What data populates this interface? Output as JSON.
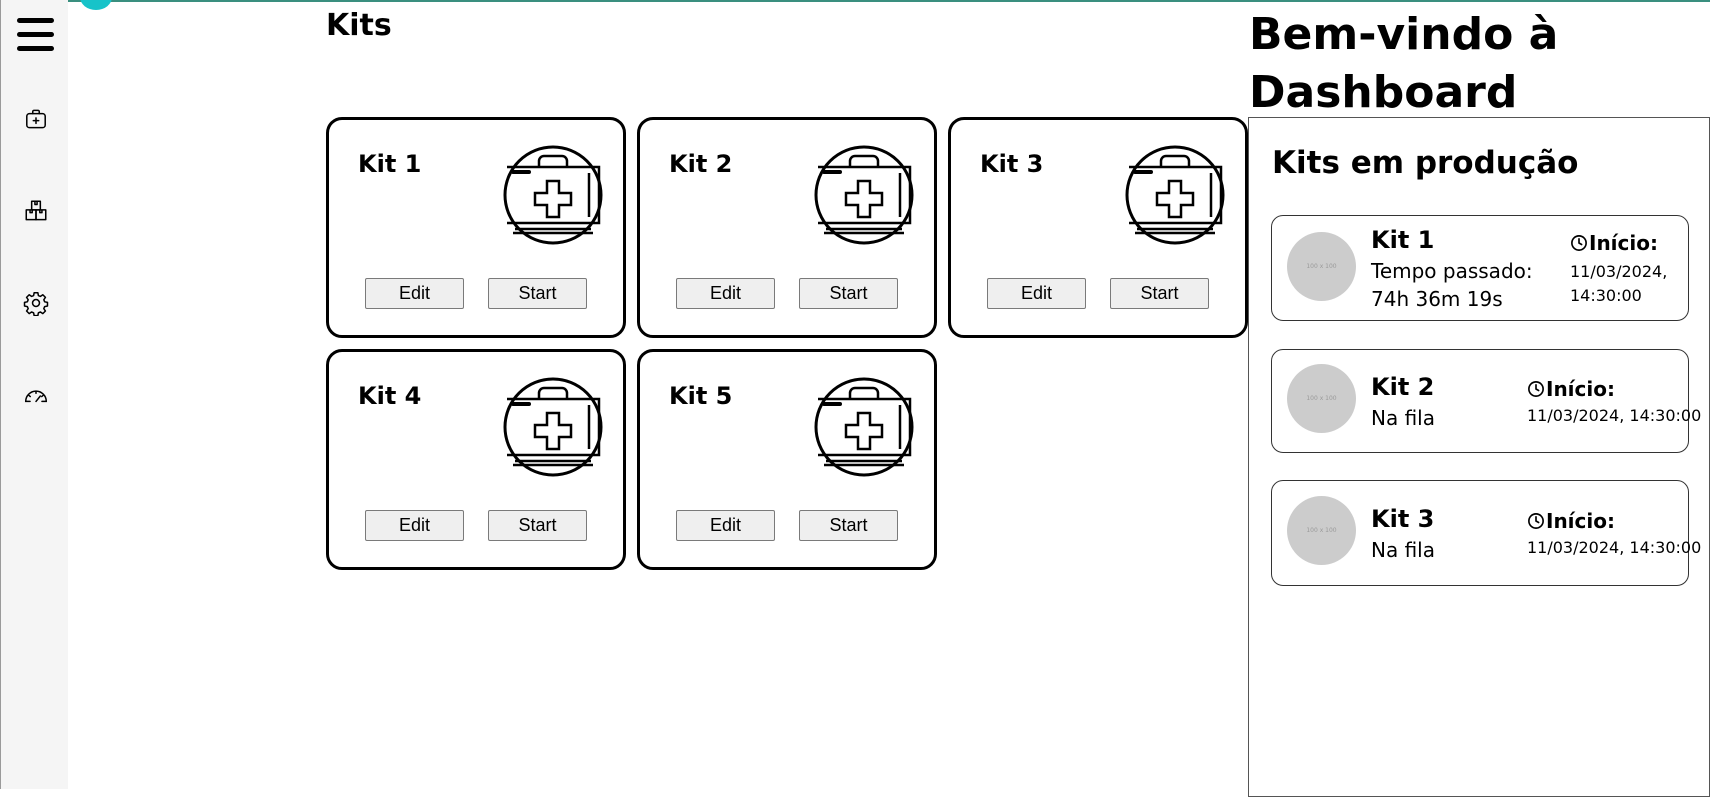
{
  "sidebar": {
    "items": [
      {
        "name": "hamburger-menu-icon"
      },
      {
        "name": "medical-kit-icon"
      },
      {
        "name": "boxes-icon"
      },
      {
        "name": "gear-icon"
      },
      {
        "name": "gauge-icon"
      }
    ]
  },
  "main": {
    "title": "Kits",
    "kits": [
      {
        "name": "Kit 1",
        "edit_label": "Edit",
        "start_label": "Start",
        "icon": "first-aid-kit-icon"
      },
      {
        "name": "Kit 2",
        "edit_label": "Edit",
        "start_label": "Start",
        "icon": "first-aid-kit-icon"
      },
      {
        "name": "Kit 3",
        "edit_label": "Edit",
        "start_label": "Start",
        "icon": "first-aid-kit-icon"
      },
      {
        "name": "Kit 4",
        "edit_label": "Edit",
        "start_label": "Start",
        "icon": "first-aid-kit-icon"
      },
      {
        "name": "Kit 5",
        "edit_label": "Edit",
        "start_label": "Start",
        "icon": "first-aid-kit-icon"
      }
    ]
  },
  "dashboard": {
    "welcome": "Bem-vindo à Dashboard",
    "production_title": "Kits em produção",
    "production": [
      {
        "name": "Kit 1",
        "status": "Tempo passado: 74h 36m 19s",
        "start_label": "Início:",
        "start_date": "11/03/2024, 14:30:00",
        "thumb_text": "100 x 100"
      },
      {
        "name": "Kit 2",
        "status": "Na fila",
        "start_label": "Início:",
        "start_date": "11/03/2024, 14:30:00",
        "thumb_text": "100 x 100"
      },
      {
        "name": "Kit 3",
        "status": "Na fila",
        "start_label": "Início:",
        "start_date": "11/03/2024, 14:30:00",
        "thumb_text": "100 x 100"
      }
    ]
  },
  "colors": {
    "accent_teal": "#17c3c9",
    "sidebar_bg": "#f5f5f5",
    "thumb_gray": "#cccccc",
    "button_bg": "#efefef"
  }
}
